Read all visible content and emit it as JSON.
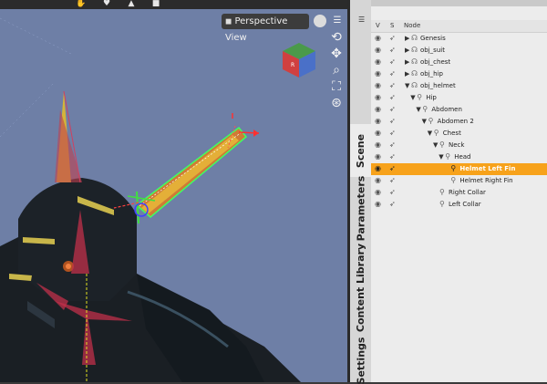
{
  "viewport": {
    "view_label": "Perspective View",
    "view_icon": "camera-icon",
    "background": "#6e7fa6",
    "toolbar_icons": [
      "bone-pose-icon",
      "figure-icon",
      "shape-icon",
      "camera-icon"
    ],
    "nav_icons": [
      "orbit-icon",
      "pan-icon",
      "zoom-icon",
      "frame-icon",
      "reset-view-icon"
    ]
  },
  "side_tabs": [
    {
      "label": "Scene",
      "active": true
    },
    {
      "label": "Parameters",
      "active": false
    },
    {
      "label": "Content Library",
      "active": false
    },
    {
      "label": "Settings",
      "active": false
    }
  ],
  "scene_panel": {
    "columns": {
      "visible": "V",
      "selectable": "S",
      "node": "Node"
    },
    "nodes": [
      {
        "label": "Genesis",
        "depth": 0,
        "expander": "▶",
        "icon": "figure-icon",
        "selected": false
      },
      {
        "label": "obj_suit",
        "depth": 0,
        "expander": "▶",
        "icon": "figure-icon",
        "selected": false
      },
      {
        "label": "obj_chest",
        "depth": 0,
        "expander": "▶",
        "icon": "figure-icon",
        "selected": false
      },
      {
        "label": "obj_hip",
        "depth": 0,
        "expander": "▶",
        "icon": "figure-icon",
        "selected": false
      },
      {
        "label": "obj_helmet",
        "depth": 0,
        "expander": "▼",
        "icon": "figure-icon",
        "selected": false
      },
      {
        "label": "Hip",
        "depth": 1,
        "expander": "▼",
        "icon": "bone-icon",
        "selected": false
      },
      {
        "label": "Abdomen",
        "depth": 2,
        "expander": "▼",
        "icon": "bone-icon",
        "selected": false
      },
      {
        "label": "Abdomen 2",
        "depth": 3,
        "expander": "▼",
        "icon": "bone-icon",
        "selected": false
      },
      {
        "label": "Chest",
        "depth": 4,
        "expander": "▼",
        "icon": "bone-icon",
        "selected": false
      },
      {
        "label": "Neck",
        "depth": 5,
        "expander": "▼",
        "icon": "bone-icon",
        "selected": false
      },
      {
        "label": "Head",
        "depth": 6,
        "expander": "▼",
        "icon": "bone-icon",
        "selected": false
      },
      {
        "label": "Helmet Left Fin",
        "depth": 7,
        "expander": "",
        "icon": "bone-icon",
        "selected": true
      },
      {
        "label": "Helmet Right Fin",
        "depth": 7,
        "expander": "",
        "icon": "bone-icon",
        "selected": false
      },
      {
        "label": "Right Collar",
        "depth": 5,
        "expander": "",
        "icon": "bone-icon",
        "selected": false
      },
      {
        "label": "Left Collar",
        "depth": 5,
        "expander": "",
        "icon": "bone-icon",
        "selected": false
      }
    ]
  },
  "colors": {
    "selection": "#f7a21b",
    "panel": "#ececec",
    "tabs": "#d6d6d6"
  }
}
